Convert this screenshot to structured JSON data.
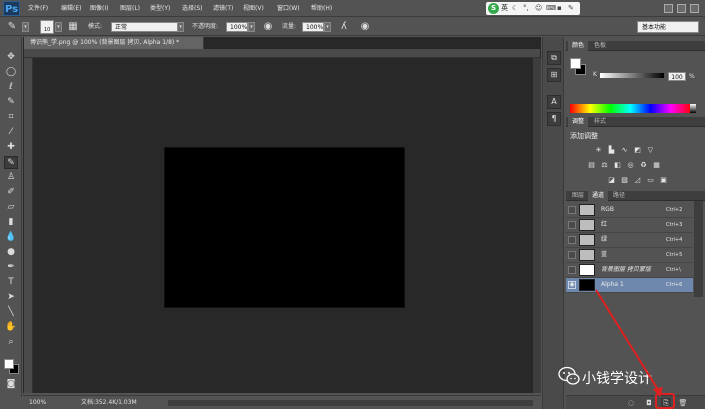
{
  "app": {
    "logo": "Ps"
  },
  "menu": [
    "文件(F)",
    "编辑(E)",
    "图像(I)",
    "图层(L)",
    "类型(Y)",
    "选择(S)",
    "滤镜(T)",
    "视图(V)",
    "窗口(W)",
    "帮助(H)"
  ],
  "ime": {
    "label": "英"
  },
  "options": {
    "brush_size": "10",
    "mode_label": "模式:",
    "mode_value": "正常",
    "opacity_label": "不透明度:",
    "opacity_value": "100%",
    "flow_label": "流量:",
    "flow_value": "100%",
    "workspace": "基本功能"
  },
  "document": {
    "tab_title": "博识熊_学.png @ 100% (背景图层 拷贝, Alpha 1/8) *",
    "zoom": "100%",
    "doc_info": "文档:352.4K/1.03M"
  },
  "color_panel": {
    "tabs": [
      "颜色",
      "色板"
    ],
    "channel_label": "K",
    "value": "100",
    "unit": "%"
  },
  "adjust_panel": {
    "tabs": [
      "调整",
      "样式"
    ],
    "heading": "添加调整"
  },
  "channels_panel": {
    "tabs": [
      "图层",
      "通道",
      "路径"
    ],
    "rows": [
      {
        "name": "RGB",
        "shortcut": "Ctrl+2"
      },
      {
        "name": "红",
        "shortcut": "Ctrl+3"
      },
      {
        "name": "绿",
        "shortcut": "Ctrl+4"
      },
      {
        "name": "蓝",
        "shortcut": "Ctrl+5"
      },
      {
        "name": "背景图层 拷贝蒙版",
        "shortcut": "Ctrl+\\"
      },
      {
        "name": "Alpha 1",
        "shortcut": "Ctrl+6"
      }
    ]
  },
  "watermark": {
    "text": "小钱学设计"
  },
  "colors": {
    "accent": "#e02020",
    "selection": "#6e88ad"
  }
}
